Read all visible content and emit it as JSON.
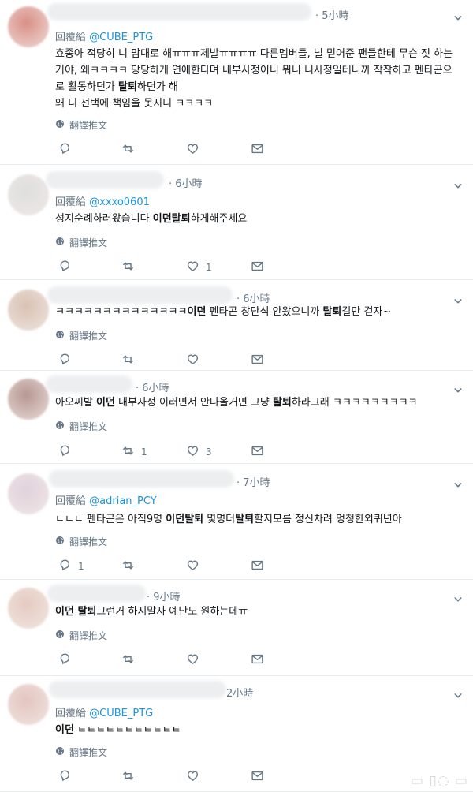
{
  "replies": [
    {
      "time": "· 5小時",
      "reply_label": "回覆給",
      "reply_handle": "@CUBE_PTG",
      "text_html": "효종아 적당히 니 맘대로 해ㅠㅠㅠ제발ㅠㅠㅠㅠ 다른멤버들, 널 믿어준 팬들한테 무슨 짓 하는거야, 왜ㅋㅋㅋㅋ 당당하게 연애한다며 내부사정이니 뭐니 니사정일테니까 작작하고 펜타곤으로 활동하던가 <b>탈퇴</b>하던가 해\n왜 니 선택에 책임을 못지니 ㅋㅋㅋㅋ",
      "translate": "翻譯推文",
      "reply_count": "",
      "retweet_count": "",
      "like_count": ""
    },
    {
      "time": "· 6小時",
      "reply_label": "回覆給",
      "reply_handle": "@xxxo0601",
      "text_html": "성지순례하러왔습니다 <b>이던탈퇴</b>하게해주세요",
      "translate": "翻譯推文",
      "reply_count": "",
      "retweet_count": "",
      "like_count": "1"
    },
    {
      "time": "· 6小時",
      "reply_label": "",
      "reply_handle": "",
      "text_html": "ㅋㅋㅋㅋㅋㅋㅋㅋㅋㅋㅋㅋㅋㅋ<b>이던</b> 펜타곤 창단식 안왔으니까 <b>탈퇴</b>길만 걷자~",
      "translate": "翻譯推文",
      "reply_count": "",
      "retweet_count": "",
      "like_count": ""
    },
    {
      "time": "· 6小時",
      "reply_label": "",
      "reply_handle": "",
      "text_html": "아오씨발 <b>이던</b> 내부사정 이러면서 안나올거면 그냥 <b>탈퇴</b>하라그래 ㅋㅋㅋㅋㅋㅋㅋㅋㅋ",
      "translate": "翻譯推文",
      "reply_count": "",
      "retweet_count": "1",
      "like_count": "3"
    },
    {
      "time": "· 7小時",
      "reply_label": "回覆給",
      "reply_handle": "@adrian_PCY",
      "text_html": "ㄴㄴㄴ 펜타곤은 아직9명 <b>이던탈퇴</b> 몇명더<b>탈퇴</b>할지모름 정신차려 멍청한외퀴년아",
      "translate": "翻譯推文",
      "reply_count": "1",
      "retweet_count": "",
      "like_count": ""
    },
    {
      "time": "· 9小時",
      "reply_label": "",
      "reply_handle": "",
      "text_html": "<b>이던 탈퇴</b>그런거 하지말자 예난도 원하는데ㅠ",
      "translate": "翻譯推文",
      "reply_count": "",
      "retweet_count": "",
      "like_count": ""
    },
    {
      "time": "2小時",
      "reply_label": "回覆給",
      "reply_handle": "@CUBE_PTG",
      "text_html": "<b>이던</b> ㅌㅌㅌㅌㅌㅌㅌㅌㅌㅌㅌ",
      "translate": "翻譯推文",
      "reply_count": "",
      "retweet_count": "",
      "like_count": ""
    }
  ],
  "colors": {
    "handle": "#1b95e0",
    "meta": "#657786",
    "text": "#14171a"
  },
  "icons": [
    "reply-icon",
    "retweet-icon",
    "like-icon",
    "message-icon",
    "globe-icon",
    "chevron-down-icon"
  ]
}
